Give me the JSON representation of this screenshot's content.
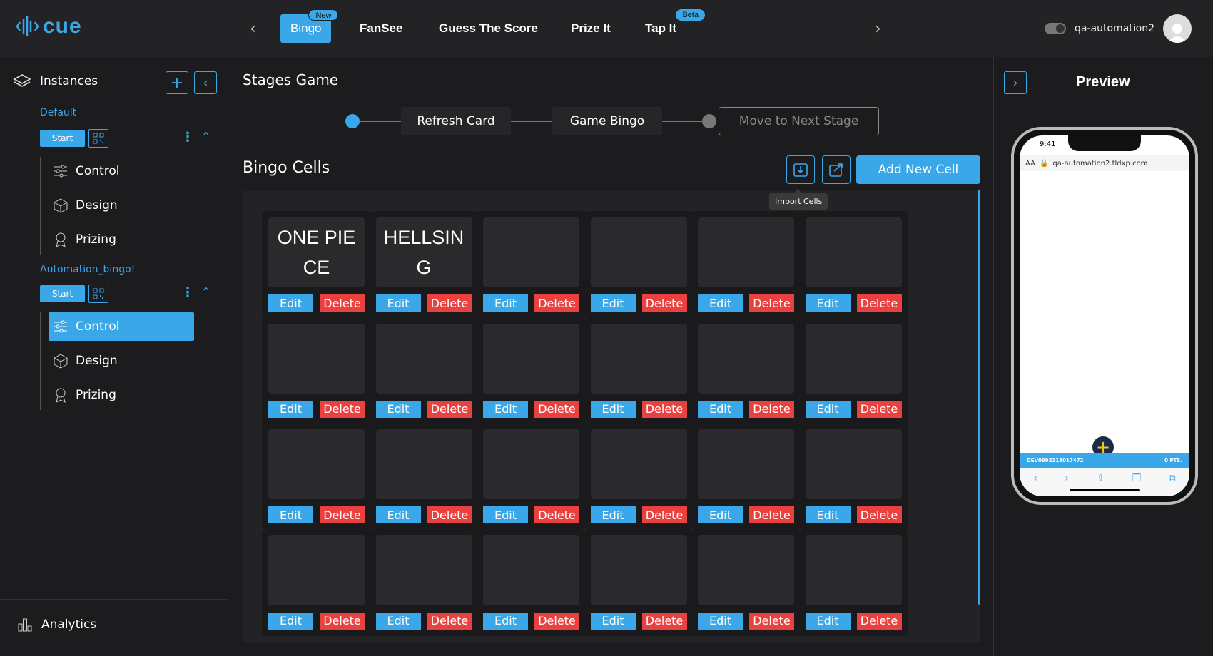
{
  "app": {
    "logo_text": "cue"
  },
  "top_nav": {
    "tabs": [
      {
        "label": "Bingo",
        "badge": "New",
        "active": true
      },
      {
        "label": "FanSee"
      },
      {
        "label": "Guess The Score"
      },
      {
        "label": "Prize It"
      },
      {
        "label": "Tap It",
        "badge": "Beta"
      }
    ],
    "username": "qa-automation2"
  },
  "sidebar": {
    "title": "Instances",
    "instances": [
      {
        "name": "Default",
        "start_label": "Start",
        "items": [
          "Control",
          "Design",
          "Prizing"
        ]
      },
      {
        "name": "Automation_bingo!",
        "start_label": "Start",
        "items": [
          "Control",
          "Design",
          "Prizing"
        ],
        "active_item": "Control"
      }
    ],
    "footer_label": "Analytics"
  },
  "main": {
    "stages_title": "Stages Game",
    "stages": [
      "Refresh Card",
      "Game Bingo"
    ],
    "next_stage_label": "Move to Next Stage",
    "cells_title": "Bingo Cells",
    "import_tooltip": "Import Cells",
    "add_cell_label": "Add New Cell",
    "edit_label": "Edit",
    "delete_label": "Delete",
    "cells": [
      "ONE PIECE",
      "HELLSING",
      "",
      "",
      "",
      "",
      "",
      "",
      "",
      "",
      "",
      "",
      "",
      "",
      "",
      "",
      "",
      "",
      "",
      "",
      "",
      "",
      "",
      ""
    ]
  },
  "preview": {
    "title": "Preview",
    "time": "9:41",
    "text_size": "AA",
    "url": "qa-automation2.tldxp.com",
    "device_id": "DEV0992118017472",
    "points": "0 PTS."
  },
  "colors": {
    "accent": "#3aa8e8",
    "danger": "#e94040",
    "bg": "#1c1c1e"
  }
}
